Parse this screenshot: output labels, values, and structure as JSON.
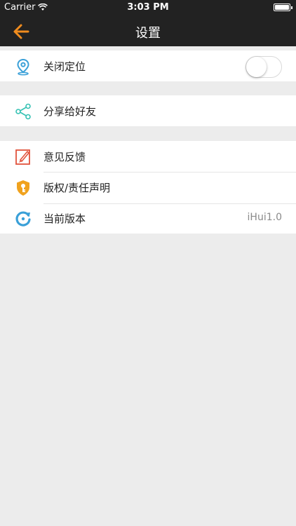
{
  "status_bar": {
    "carrier": "Carrier",
    "time": "3:03 PM"
  },
  "nav": {
    "title": "设置",
    "back_icon": "arrow-left-icon",
    "accent_color": "#f08c1e"
  },
  "settings": {
    "location": {
      "label": "关闭定位",
      "icon": "location-pin-icon",
      "toggle_on": false
    },
    "share": {
      "label": "分享给好友",
      "icon": "share-icon"
    },
    "feedback": {
      "label": "意见反馈",
      "icon": "edit-pen-icon"
    },
    "copyright": {
      "label": "版权/责任声明",
      "icon": "shield-key-icon"
    },
    "version": {
      "label": "当前版本",
      "icon": "refresh-icon",
      "value": "iHui1.0"
    }
  }
}
